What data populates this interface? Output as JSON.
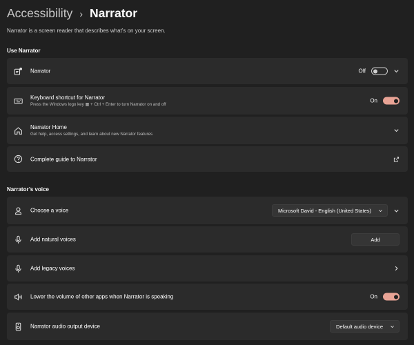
{
  "header": {
    "breadcrumb_parent": "Accessibility",
    "breadcrumb_sep": "›",
    "breadcrumb_current": "Narrator",
    "description": "Narrator is a screen reader that describes what’s on your screen."
  },
  "sections": {
    "use_narrator": "Use Narrator",
    "narrators_voice": "Narrator’s voice"
  },
  "cards": {
    "narrator": {
      "title": "Narrator",
      "state_label": "Off",
      "state": false
    },
    "keyboard_shortcut": {
      "title": "Keyboard shortcut for Narrator",
      "subtitle": "Press the Windows logo key ▦ + Ctrl + Enter to turn Narrator on and off",
      "state_label": "On",
      "state": true
    },
    "narrator_home": {
      "title": "Narrator Home",
      "subtitle": "Get help, access settings, and learn about new Narrator features"
    },
    "complete_guide": {
      "title": "Complete guide to Narrator"
    },
    "choose_voice": {
      "title": "Choose a voice",
      "selected": "Microsoft David - English (United States)"
    },
    "natural_voices": {
      "title": "Add natural voices",
      "button": "Add"
    },
    "legacy_voices": {
      "title": "Add legacy voices"
    },
    "lower_volume": {
      "title": "Lower the volume of other apps when Narrator is speaking",
      "state_label": "On",
      "state": true
    },
    "audio_output": {
      "title": "Narrator audio output device",
      "selected": "Default audio device"
    }
  },
  "colors": {
    "background": "#202020",
    "card": "#2b2b2b",
    "accent": "#e8a395"
  },
  "icons": {
    "narrator": "narrator-icon",
    "keyboard": "keyboard-icon",
    "home": "home-icon",
    "help": "help-icon",
    "voice": "person-voice-icon",
    "microphone": "microphone-icon",
    "volume": "volume-icon",
    "speaker": "speaker-device-icon"
  }
}
